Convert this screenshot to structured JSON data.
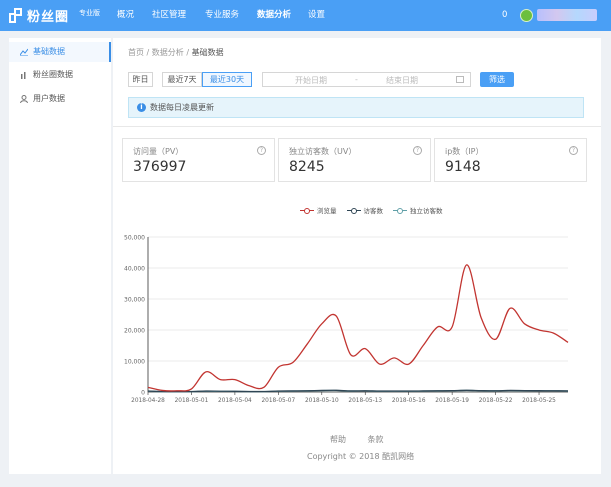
{
  "app": {
    "title": "粉丝圈",
    "badge": "专业版"
  },
  "topnav": [
    {
      "label": "概况"
    },
    {
      "label": "社区管理"
    },
    {
      "label": "专业服务"
    },
    {
      "label": "数据分析",
      "active": true
    },
    {
      "label": "设置"
    }
  ],
  "header": {
    "notification_count": "0"
  },
  "sidebar": {
    "items": [
      {
        "label": "基础数据",
        "icon": "line-chart-icon",
        "active": true
      },
      {
        "label": "粉丝圈数据",
        "icon": "bar-chart-icon"
      },
      {
        "label": "用户数据",
        "icon": "user-icon"
      }
    ]
  },
  "breadcrumb": {
    "home": "首页",
    "sep": "/",
    "parent": "数据分析",
    "current": "基础数据"
  },
  "filters": {
    "ranges": [
      {
        "label": "昨日"
      },
      {
        "label": "最近7天"
      },
      {
        "label": "最近30天",
        "selected": true
      }
    ],
    "start_placeholder": "开始日期",
    "range_sep": "-",
    "end_placeholder": "结束日期",
    "filter_button": "筛选"
  },
  "notice": {
    "text": "数据每日凌晨更新"
  },
  "stats": [
    {
      "label": "访问量（PV）",
      "value": "376997"
    },
    {
      "label": "独立访客数（UV）",
      "value": "8245"
    },
    {
      "label": "ip数（IP）",
      "value": "9148"
    }
  ],
  "chart_data": {
    "type": "line",
    "x": [
      "2018-04-28",
      "2018-04-29",
      "2018-04-30",
      "2018-05-01",
      "2018-05-02",
      "2018-05-03",
      "2018-05-04",
      "2018-05-05",
      "2018-05-06",
      "2018-05-07",
      "2018-05-08",
      "2018-05-09",
      "2018-05-10",
      "2018-05-11",
      "2018-05-12",
      "2018-05-13",
      "2018-05-14",
      "2018-05-15",
      "2018-05-16",
      "2018-05-17",
      "2018-05-18",
      "2018-05-19",
      "2018-05-20",
      "2018-05-21",
      "2018-05-22",
      "2018-05-23",
      "2018-05-24",
      "2018-05-25",
      "2018-05-26",
      "2018-05-27"
    ],
    "x_tick_labels": [
      "2018-04-28",
      "2018-05-01",
      "2018-05-04",
      "2018-05-07",
      "2018-05-10",
      "2018-05-13",
      "2018-05-16",
      "2018-05-19",
      "2018-05-22",
      "2018-05-25"
    ],
    "series": [
      {
        "name": "浏览量",
        "color": "#c23531",
        "values": [
          1500,
          500,
          400,
          1000,
          6500,
          4000,
          4000,
          2000,
          1500,
          8000,
          9500,
          15500,
          22000,
          24500,
          12000,
          14000,
          9000,
          11000,
          9000,
          15000,
          21000,
          21000,
          41000,
          24000,
          17000,
          27000,
          22000,
          20000,
          19000,
          16000
        ]
      },
      {
        "name": "访客数",
        "color": "#2f4554",
        "values": [
          300,
          150,
          120,
          150,
          300,
          250,
          220,
          150,
          150,
          300,
          350,
          400,
          500,
          550,
          350,
          380,
          300,
          320,
          300,
          350,
          400,
          450,
          550,
          450,
          400,
          500,
          450,
          420,
          400,
          350
        ]
      },
      {
        "name": "独立访客数",
        "color": "#61a0a8",
        "values": [
          250,
          120,
          100,
          130,
          250,
          200,
          180,
          130,
          130,
          250,
          300,
          350,
          450,
          480,
          300,
          330,
          260,
          280,
          260,
          300,
          350,
          400,
          500,
          400,
          350,
          450,
          400,
          380,
          360,
          300
        ]
      }
    ],
    "ylim": [
      0,
      50000
    ],
    "y_tick_labels": [
      "0",
      "10,000",
      "20,000",
      "30,000",
      "40,000",
      "50,000"
    ],
    "grid": true,
    "legend_position": "top"
  },
  "footer": {
    "links": [
      "帮助",
      "条款"
    ],
    "copyright": "Copyright © 2018 酷凯网络"
  }
}
